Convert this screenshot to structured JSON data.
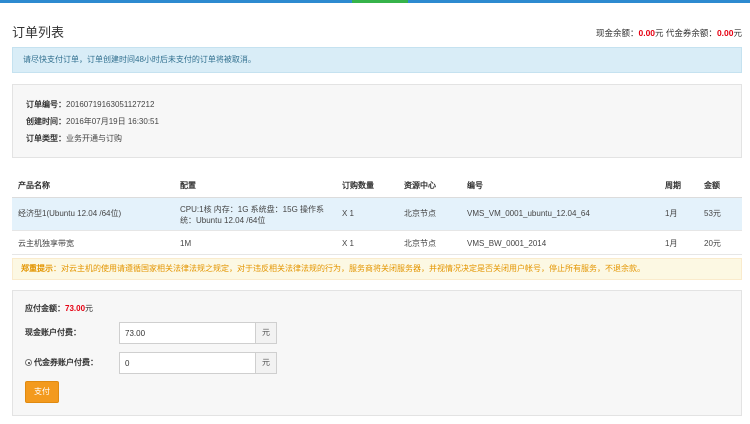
{
  "header": {
    "title": "订单列表",
    "cash_balance_label": "现金余额：",
    "cash_balance_value": "0.00",
    "cash_balance_unit": "元",
    "voucher_balance_label": "代金券余额：",
    "voucher_balance_value": "0.00",
    "voucher_balance_unit": "元"
  },
  "notice": "请尽快支付订单，订单创建时间48小时后未支付的订单将被取消。",
  "order": {
    "number_label": "订单编号：",
    "number": "20160719163051127212",
    "created_label": "创建时间：",
    "created": "2016年07月19日 16:30:51",
    "type_label": "订单类型：",
    "type": "业务开通与订购"
  },
  "table": {
    "columns": [
      "产品名称",
      "配置",
      "订购数量",
      "资源中心",
      "编号",
      "周期",
      "金额"
    ],
    "rows": [
      {
        "product": "经济型1(Ubuntu 12.04 /64位)",
        "config": "CPU:1核 内存：1G 系统盘：15G 操作系统：Ubuntu 12.04 /64位",
        "qty": "X 1",
        "center": "北京节点",
        "code": "VMS_VM_0001_ubuntu_12.04_64",
        "period": "1月",
        "amount": "53元"
      },
      {
        "product": "云主机独享带宽",
        "config": "1M",
        "qty": "X 1",
        "center": "北京节点",
        "code": "VMS_BW_0001_2014",
        "period": "1月",
        "amount": "20元"
      }
    ]
  },
  "warning": {
    "title": "郑重提示",
    "text": "：对云主机的使用请遵循国家相关法律法规之规定，对于违反相关法律法规的行为，服务商将关闭服务器，并视情况决定是否关闭用户帐号，停止所有服务，不退余款。"
  },
  "payment": {
    "due_label": "应付金额：",
    "due_amount": "73.00",
    "due_unit": "元",
    "cash_label": "现金账户付费：",
    "cash_value": "73.00",
    "cash_unit": "元",
    "voucher_label": "代金券账户付费：",
    "voucher_value": "0",
    "voucher_unit": "元",
    "pay_button": "支付"
  },
  "colors": {
    "accent_blue": "#2d8ad0",
    "accent_green": "#36b34a",
    "price_red": "#e60012",
    "button_orange": "#f39a1e",
    "warning_text": "#e39500"
  }
}
